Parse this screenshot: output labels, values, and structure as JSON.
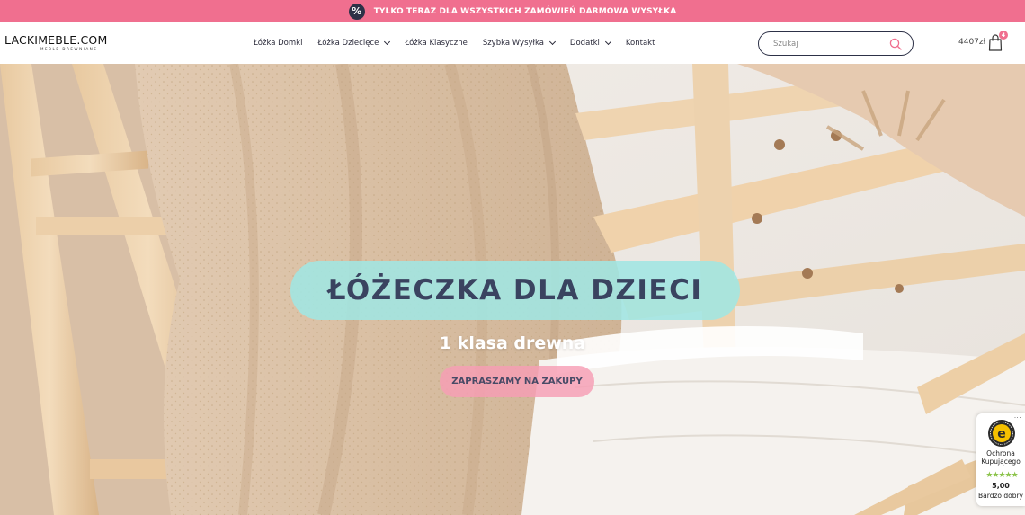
{
  "promo": {
    "icon": "percent-icon",
    "text": "TYLKO TERAZ DLA WSZYSTKICH ZAMÓWIEŃ DARMOWA WYSYŁKA",
    "bg_color": "#f06f8f"
  },
  "header": {
    "logo_text": "LACKIMEBLE.COM",
    "logo_subtext": "MEBLE DREWNIANE",
    "nav": [
      {
        "label": "Łóżka Domki",
        "has_dropdown": false
      },
      {
        "label": "Łóżka Dziecięce",
        "has_dropdown": true
      },
      {
        "label": "Łóżka Klasyczne",
        "has_dropdown": false
      },
      {
        "label": "Szybka Wysyłka",
        "has_dropdown": true
      },
      {
        "label": "Dodatki",
        "has_dropdown": true
      },
      {
        "label": "Kontakt",
        "has_dropdown": false
      }
    ],
    "search_placeholder": "Szukaj",
    "search_icon": "search-icon",
    "cart_total": "4407zł",
    "cart_count": "4",
    "cart_icon": "shopping-bag-icon",
    "accent_color": "#f06f8f"
  },
  "hero": {
    "title": "ŁÓŻECZKA DLA DZIECI",
    "subtitle": "1 klasa drewna",
    "cta_label": "ZAPRASZAMY NA ZAKUPY",
    "title_pill_color": "#a0e6e2",
    "cta_color": "#f69eb4"
  },
  "trust_badge": {
    "menu": "···",
    "seal_letter": "e",
    "label": "Ochrona Kupującego",
    "stars": "★★★★★",
    "score": "5,00",
    "rating": "Bardzo dobry",
    "star_color": "#8bc34a"
  }
}
